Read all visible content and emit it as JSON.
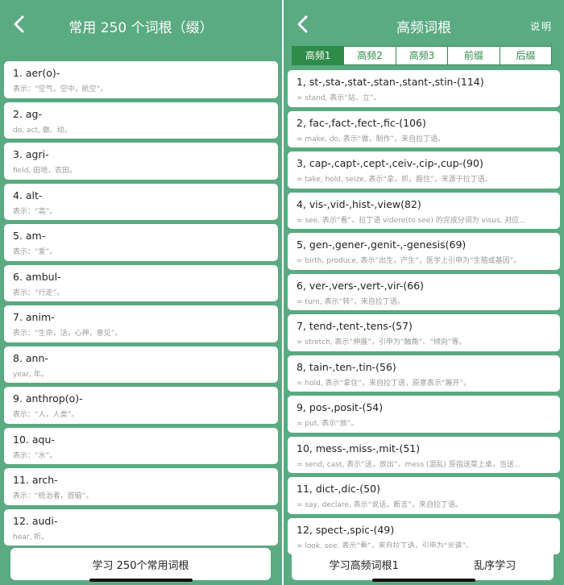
{
  "left": {
    "title": "常用 250 个词根（缀）",
    "items": [
      {
        "name": "1. aer(o)-",
        "desc": "表示：“空气，空中，航空”。"
      },
      {
        "name": "2. ag-",
        "desc": "do, act, 做、动。"
      },
      {
        "name": "3. agri-",
        "desc": "field, 田地，农田。"
      },
      {
        "name": "4. alt-",
        "desc": "表示：“高”。"
      },
      {
        "name": "5. am-",
        "desc": "表示：“爱”。"
      },
      {
        "name": "6. ambul-",
        "desc": "表示：“行走”。"
      },
      {
        "name": "7. anim-",
        "desc": "表示：“生命，活，心神，意见”。"
      },
      {
        "name": "8. ann-",
        "desc": "year, 年。"
      },
      {
        "name": "9. anthrop(o)-",
        "desc": "表示：“人，人类”。"
      },
      {
        "name": "10. aqu-",
        "desc": "表示：“水”。"
      },
      {
        "name": "11. arch-",
        "desc": "表示：“统治者，首脑”。"
      },
      {
        "name": "12. audi-",
        "desc": "hear, 听。"
      }
    ],
    "bottom_button": "学习 250个常用词根"
  },
  "right": {
    "title": "高频词根",
    "help": "说明",
    "tabs": [
      "高频1",
      "高频2",
      "高频3",
      "前缀",
      "后缀"
    ],
    "active_tab": 0,
    "items": [
      {
        "name": "1, st-,sta-,stat-,stan-,stant-,stin-(114)",
        "desc": "= stand, 表示“站、立”。"
      },
      {
        "name": "2, fac-,fact-,fect-,fic-(106)",
        "desc": "= make, do, 表示“做，制作”，来自拉丁语。"
      },
      {
        "name": "3, cap-,capt-,cept-,ceiv-,cip-,cup-(90)",
        "desc": "= take, hold, seize, 表示“拿，抓，握住”，来源于拉丁语。"
      },
      {
        "name": "4, vis-,vid-,hist-,view(82)",
        "desc": "= see, 表示“看”，拉丁语 videre(to see) 的完成分词为 visus, 对应..."
      },
      {
        "name": "5, gen-,gener-,genit-,-genesis(69)",
        "desc": "= birth, produce, 表示“出生，产生”，医学上引申为“生殖或基因”。"
      },
      {
        "name": "6, ver-,vers-,vert-,vir-(66)",
        "desc": "= turn, 表示“转”，来自拉丁语。"
      },
      {
        "name": "7, tend-,tent-,tens-(57)",
        "desc": "= stretch, 表示“伸展”，引申为“触角”、“倾向”等。"
      },
      {
        "name": "8, tain-,ten-,tin-(56)",
        "desc": "= hold, 表示“拿住”，来自拉丁语，原意表示“展开”。"
      },
      {
        "name": "9, pos-,posit-(54)",
        "desc": "= put, 表示“放”。"
      },
      {
        "name": "10, mess-,miss-,mit-(51)",
        "desc": "= send, cast, 表示“送，放出”。mess (混乱) 原指送菜上桌，当送..."
      },
      {
        "name": "11, dict-,dic-(50)",
        "desc": "= say, declare, 表示“说话，断言”，来自拉丁语。"
      },
      {
        "name": "12, spect-,spic-(49)",
        "desc": "= look, see, 表示“看”，来自拉丁语，引申为“光谱”。"
      }
    ],
    "bottom_buttons": [
      "学习高频词根1",
      "乱序学习"
    ]
  },
  "icons": {
    "back": "chevron-left-icon"
  },
  "colors": {
    "panel_bg": "#5aaa82",
    "tab_accent": "#2f8b49"
  }
}
